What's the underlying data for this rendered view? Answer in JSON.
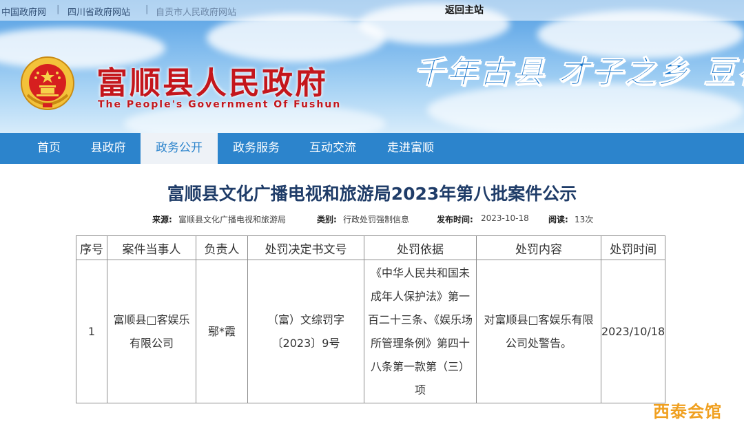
{
  "toplinks": [
    "中国政府网",
    "四川省政府网站",
    "自贡市人民政府网站"
  ],
  "home_link": "返回主站",
  "site": {
    "title": "富顺县人民政府",
    "subtitle": "The People's Government Of Fushun",
    "slogan": "千年古县  才子之乡  豆花"
  },
  "nav": {
    "items": [
      "首页",
      "县政府",
      "政务公开",
      "政务服务",
      "互动交流",
      "走进富顺"
    ],
    "active": "政务公开"
  },
  "article": {
    "title": "富顺县文化广播电视和旅游局2023年第八批案件公示",
    "meta": {
      "source_label": "来源:",
      "source": "富顺县文化广播电视和旅游局",
      "category_label": "类别:",
      "category": "行政处罚强制信息",
      "date_label": "发布时间:",
      "date": "2023-10-18",
      "views_label": "阅读:",
      "views": "13次"
    }
  },
  "table": {
    "headers": [
      "序号",
      "案件当事人",
      "负责人",
      "处罚决定书文号",
      "处罚依据",
      "处罚内容",
      "处罚时间"
    ],
    "row": {
      "index": "1",
      "party": "富顺县□客娱乐有限公司",
      "person": "鄢*霞",
      "doc_no": "（富）文综罚字〔2023〕9号",
      "basis": "《中华人民共和国未成年人保护法》第一百二十三条、《娱乐场所管理条例》第四十八条第一款第（三）项",
      "content": "对富顺县□客娱乐有限公司处警告。",
      "date": "2023/10/18"
    }
  },
  "watermark": "西泰会馆",
  "colors": {
    "nav_bg": "#2c84cc",
    "title_red": "#c4161c",
    "slogan_blue": "#0e6fc8",
    "article_title": "#1f3c68"
  }
}
